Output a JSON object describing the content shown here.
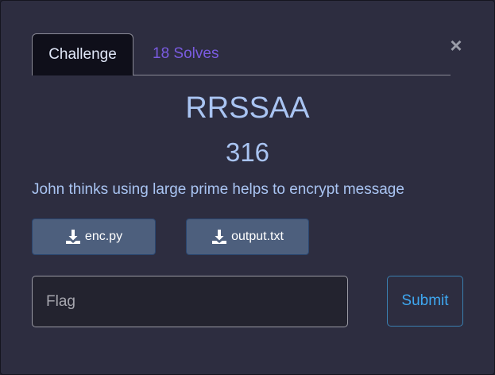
{
  "close": {
    "glyph": "×",
    "icon": "close-icon"
  },
  "tabs": [
    {
      "label": "Challenge",
      "active": true
    },
    {
      "label": "18 Solves",
      "active": false
    }
  ],
  "challenge": {
    "title": "RRSSAA",
    "points": "316",
    "description": "John thinks using large prime helps to encrypt message"
  },
  "files": [
    {
      "label": "enc.py",
      "icon": "download-icon"
    },
    {
      "label": "output.txt",
      "icon": "download-icon"
    }
  ],
  "flag": {
    "placeholder": "Flag",
    "value": ""
  },
  "submit": {
    "label": "Submit"
  },
  "colors": {
    "background": "#2d2d40",
    "active_tab": "#0f0f1a",
    "solves_tab": "#7a5be0",
    "title_text": "#a9c4f2",
    "file_button": "#4d5f7d",
    "submit_text": "#3ea7f0"
  }
}
